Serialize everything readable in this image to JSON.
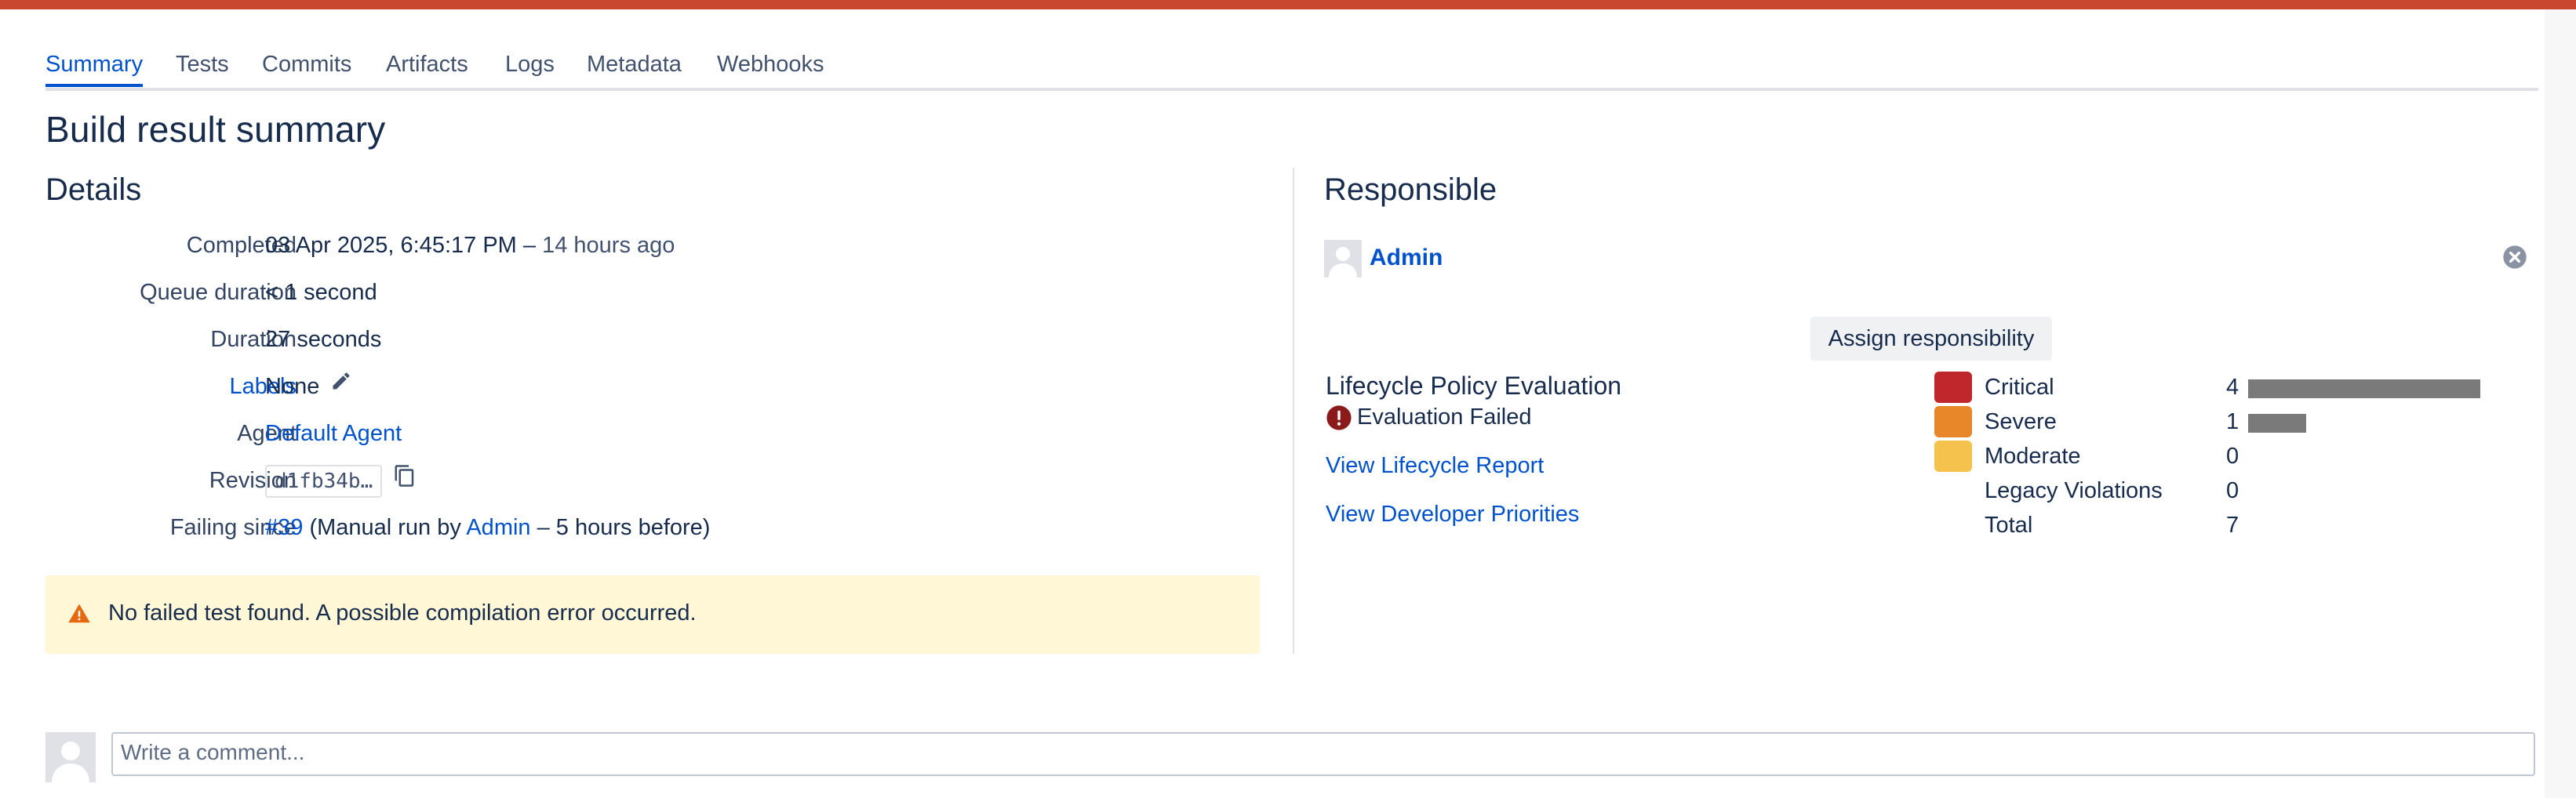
{
  "tabs": [
    {
      "label": "Summary",
      "active": true
    },
    {
      "label": "Tests"
    },
    {
      "label": "Commits"
    },
    {
      "label": "Artifacts"
    },
    {
      "label": "Logs"
    },
    {
      "label": "Metadata"
    },
    {
      "label": "Webhooks"
    }
  ],
  "page_title": "Build result summary",
  "details": {
    "title": "Details",
    "completed_label": "Completed",
    "completed_value": "03 Apr 2025, 6:45:17 PM",
    "completed_sep": " – ",
    "completed_ago": "14 hours ago",
    "queue_label": "Queue duration",
    "queue_value": "< 1 second",
    "duration_label": "Duration",
    "duration_value": "27 seconds",
    "labels_label": "Labels",
    "labels_value": "None",
    "agent_label": "Agent",
    "agent_value": "Default Agent",
    "revision_label": "Revision",
    "revision_value": "d1fb34b…",
    "failing_label": "Failing since",
    "failing_build": "#39",
    "failing_mid": " (Manual run by ",
    "failing_user": "Admin",
    "failing_end": " – 5 hours before)"
  },
  "warning": {
    "text": "No failed test found. A possible compilation error occurred."
  },
  "responsible": {
    "title": "Responsible",
    "user": "Admin",
    "assign_button": "Assign responsibility"
  },
  "lifecycle": {
    "title": "Lifecycle Policy Evaluation",
    "status": "Evaluation Failed",
    "view_report": "View Lifecycle Report",
    "view_priorities": "View Developer Priorities",
    "rows": [
      {
        "label": "Critical",
        "count": "4",
        "color": "#c0272d",
        "value": 4
      },
      {
        "label": "Severe",
        "count": "1",
        "color": "#e8862a",
        "value": 1
      },
      {
        "label": "Moderate",
        "count": "0",
        "color": "#f5c34d",
        "value": 0
      },
      {
        "label": "Legacy Violations",
        "count": "0"
      },
      {
        "label": "Total",
        "count": "7"
      }
    ]
  },
  "comment": {
    "placeholder": "Write a comment..."
  },
  "colors": {
    "top_bar": "#c9472f",
    "link": "#0052cc",
    "warning_bg": "#fff7d6",
    "warning_icon": "#e56910",
    "error_icon": "#8b1a1a"
  }
}
